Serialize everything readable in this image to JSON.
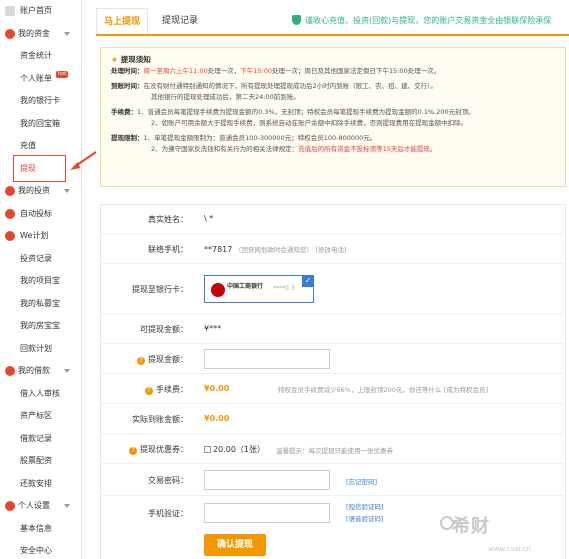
{
  "sidebar": {
    "home": "账户首页",
    "funds_section": "我的资金",
    "funds_items": [
      "资金统计",
      "个人账单",
      "我的银行卡",
      "我的回宝箱",
      "充值",
      "提现"
    ],
    "hot_badge": "hot",
    "invest_section": "我的投资",
    "invest_items": [
      "自动投标",
      "We计划",
      "投资记录",
      "我的项目宝",
      "我的私募宝",
      "我的房宝宝",
      "回款计划"
    ],
    "loan_section": "我的借款",
    "loan_items": [
      "借入人审核",
      "资产标区",
      "借款记录",
      "股票配资",
      "还款安排"
    ],
    "settings_section": "个人设置",
    "settings_items": [
      "基本信息",
      "安全中心"
    ],
    "accent": "#e8452f"
  },
  "tabs": {
    "active": "马上提现",
    "second": "提现记录"
  },
  "notice_banner": "谨收心充值、投资(回款)与提现，您的账户交易资金全由银联保险承保",
  "notice_box": {
    "title": "提现须知",
    "time_label": "处理时间：",
    "time_red1": "周一至周六上午11:00",
    "time_mid": "处理一次，",
    "time_red2": "下午15:00",
    "time_tail": "处理一次；周日及其他国家法定假日下午15:00处理一次。",
    "arrival_label": "到账时间：",
    "arrival_text": "在没有财付通特别通知的情况下，所有提现处理提现成功后2小时内到账（限工、农、招、建、交行）。",
    "arrival_text2": "其他银行的提现处理成功后，第二天24:00前到账。",
    "fee_label": "手续费：",
    "fee_text1": "1、普通会员每笔提现手续费为提现金额的0.3%，无封顶；特权会员每笔提现手续费为提现金额的0.1%,200元封顶。",
    "fee_text2": "2、如账户可用余额大于提现手续费，则系统自动在账户余额中扣除手续费，否则提现费用在提现金额中扣除。",
    "limit_label": "提现限制：",
    "limit_text1": "1、单笔提现金额限制为：普通会员100-300000元；特权会员100-800000元。",
    "limit_text2_a": "2、为遵守国家反洗钱和有关行为的相关法律规定：",
    "limit_text2_red": "充值后的所有资金不投标须等15天后才能提现。"
  },
  "form": {
    "real_name_label": "真实姓名：",
    "real_name_value": "\\ *",
    "phone_label": "联络手机：",
    "phone_value": "**7817",
    "phone_hint": "（团贷网划款时会通知您）",
    "phone_link": "[修改电话]",
    "bank_label": "提现至银行卡：",
    "bank_name": "中国工商银行",
    "bank_tail": "****0 3",
    "available_label": "可提现金额：",
    "available_value": "¥***",
    "amount_label": "提现金额：",
    "fee_label": "手续费：",
    "fee_value": "¥0.00",
    "fee_hint": "特权会员手续费减少66%，上限封顶200元，你还等什么",
    "fee_link": "[成为特权会员]",
    "actual_label": "实际到账金额：",
    "actual_value": "¥0.00",
    "coupon_label": "提现优惠券：",
    "coupon_value": "20.00（1张）",
    "coupon_hint": "温馨提示：每次提现只能使用一张优惠券",
    "password_label": "交易密码：",
    "password_link": "[忘记密码]",
    "sms_label": "手机验证：",
    "sms_link": "[短信验证码]",
    "voice_link": "[语音验证码]",
    "submit": "确认提现"
  },
  "watermark": {
    "text": "希财",
    "url": "www.csai.cn"
  }
}
